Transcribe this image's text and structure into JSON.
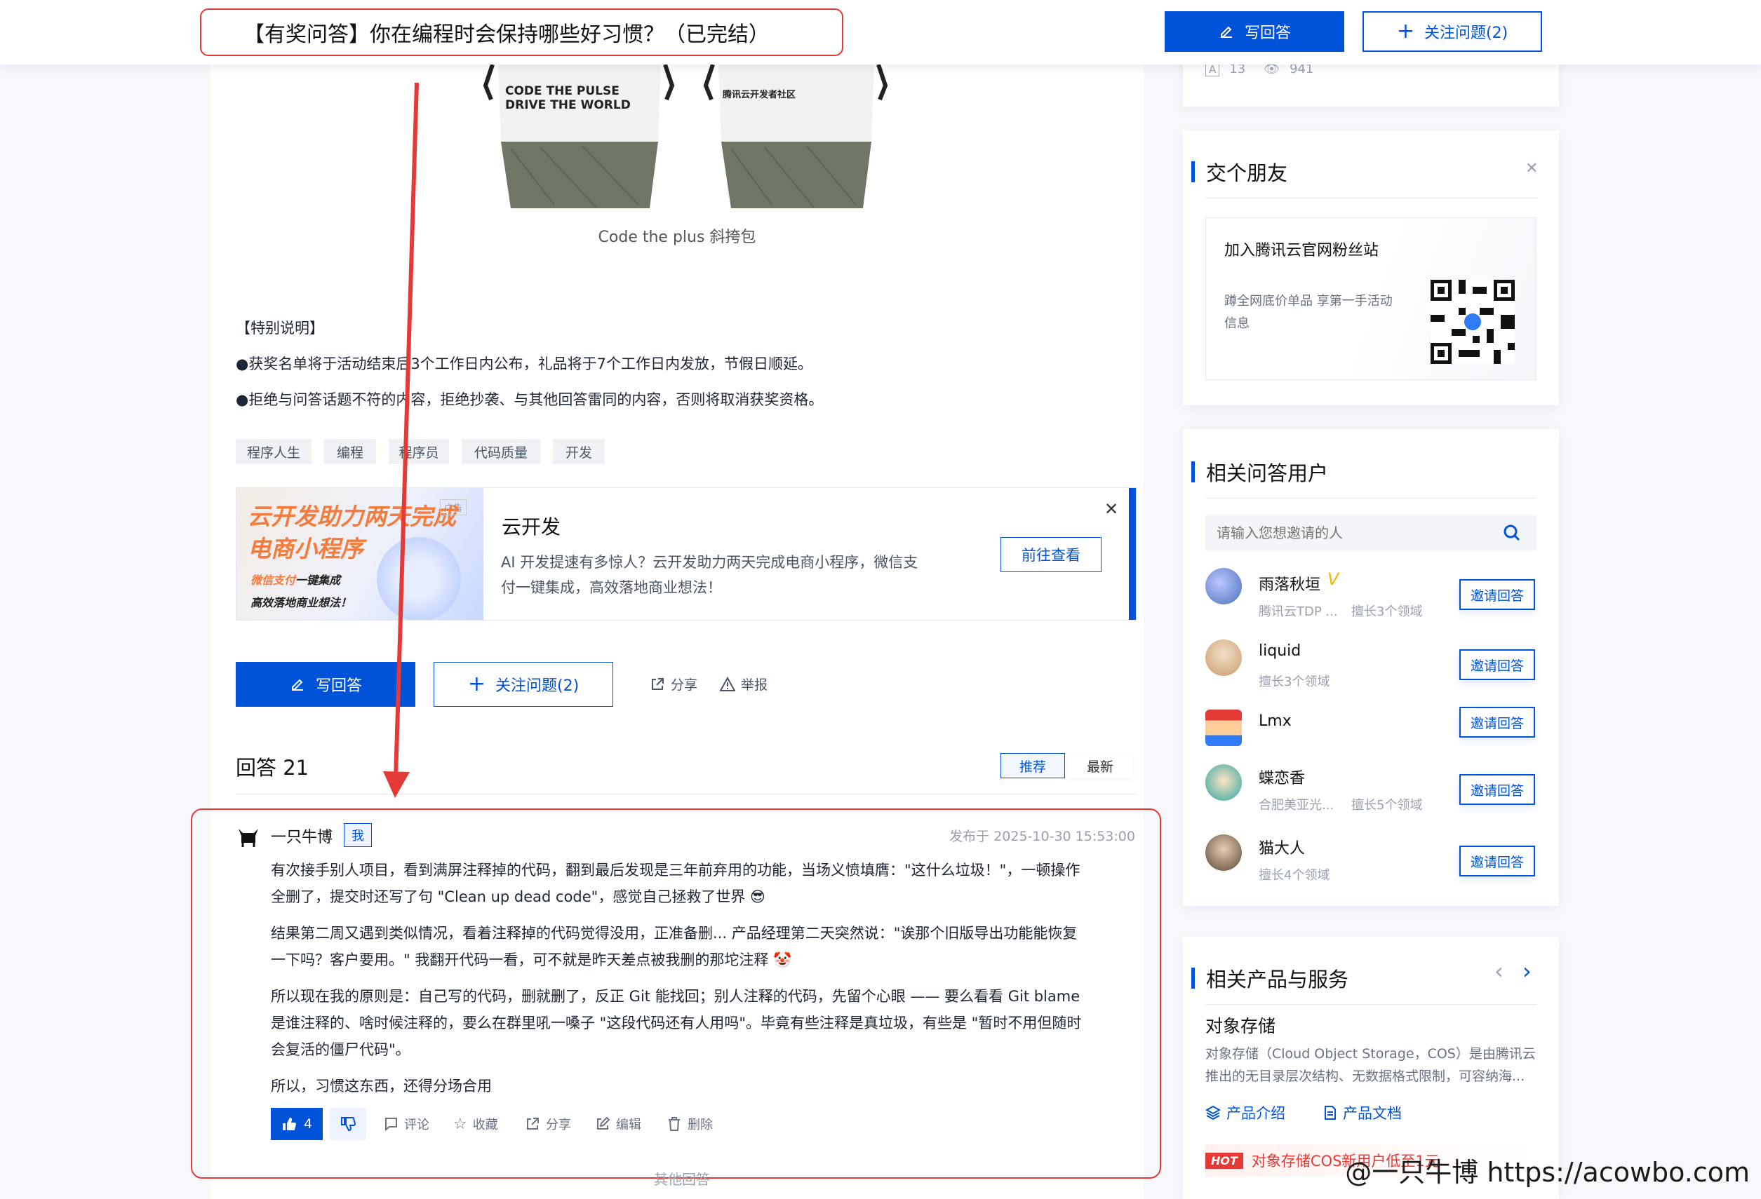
{
  "header": {
    "title": "【有奖问答】你在编程时会保持哪些好习惯？（已完结）",
    "write_answer": "写回答",
    "follow": "关注问题(2)"
  },
  "stats": {
    "answers": "13",
    "views": "941"
  },
  "image": {
    "left_text_line1": "CODE THE PULSE",
    "left_text_line2": "DRIVE THE WORLD",
    "right_text": "腾讯云开发者社区",
    "caption": "Code the plus 斜挎包"
  },
  "notes": {
    "heading": "【特别说明】",
    "line1": "●获奖名单将于活动结束后3个工作日内公布，礼品将于7个工作日内发放，节假日顺延。",
    "line2": "●拒绝与问答话题不符的内容，拒绝抄袭、与其他回答雷同的内容，否则将取消获奖资格。"
  },
  "tags": [
    "程序人生",
    "编程",
    "程序员",
    "代码质量",
    "开发"
  ],
  "ad": {
    "img_title1": "云开发助力两天完成",
    "img_title2": "电商小程序",
    "img_sub1_pre": "微信支付",
    "img_sub1_post": "一键集成",
    "img_sub2": "高效落地商业想法！",
    "img_badge": "广告",
    "title": "云开发",
    "desc1": "AI 开发提速有多惊人？云开发助力两天完成电商小程序，微信支",
    "desc2": "付一键集成，高效落地商业想法！",
    "cta": "前往查看",
    "close": "✕"
  },
  "actions": {
    "write_answer": "写回答",
    "follow": "关注问题(2)",
    "share": "分享",
    "report": "举报"
  },
  "answers_header": {
    "title": "回答 21",
    "sort_recommend": "推荐",
    "sort_latest": "最新"
  },
  "answer": {
    "author": "一只牛博",
    "me_badge": "我",
    "published": "发布于 2025-10-30 15:53:00",
    "p1a": "有次接手别人项目，看到满屏注释掉的代码，翻到最后发现是三年前弃用的功能，当场义愤填膺：\"这什么垃圾！\"，一顿操作",
    "p1b": "全删了，提交时还写了句 \"Clean up dead code\"，感觉自己拯救了世界 😎",
    "p2a": "结果第二周又遇到类似情况，看着注释掉的代码觉得没用，正准备删... 产品经理第二天突然说：\"诶那个旧版导出功能能恢复",
    "p2b": "一下吗？客户要用。\" 我翻开代码一看，可不就是昨天差点被我删的那坨注释 🤡",
    "p3a": "所以现在我的原则是：自己写的代码，删就删了，反正 Git 能找回；别人注释的代码，先留个心眼 —— 要么看看 Git blame",
    "p3b": "是谁注释的、啥时候注释的，要么在群里吼一嗓子 \"这段代码还有人用吗\"。毕竟有些注释是真垃圾，有些是 \"暂时不用但随时",
    "p3c": "会复活的僵尸代码\"。",
    "p4": "所以，习惯这东西，还得分场合用",
    "likes": "4",
    "comment": "评论",
    "collect": "收藏",
    "share": "分享",
    "edit": "编辑",
    "delete": "删除"
  },
  "other_answers": "其他回答",
  "sidebar": {
    "friends": {
      "title": "交个朋友",
      "close": "✕",
      "heading": "加入腾讯云官网粉丝站",
      "desc1": "蹲全网底价单品 享第一手活动",
      "desc2": "信息"
    },
    "users": {
      "title": "相关问答用户",
      "search_placeholder": "请输入您想邀请的人",
      "invite_label": "邀请回答",
      "items": [
        {
          "name": "雨落秋垣",
          "badge": "V",
          "sub1": "腾讯云TDP ...",
          "sub2": "擅长3个领域"
        },
        {
          "name": "liquid",
          "sub1": "擅长3个领域"
        },
        {
          "name": "Lmx"
        },
        {
          "name": "蝶恋香",
          "sub1": "合肥美亚光...",
          "sub2": "擅长5个领域"
        },
        {
          "name": "猫大人",
          "sub1": "擅长4个领域"
        }
      ]
    },
    "products": {
      "title": "相关产品与服务",
      "prev": "‹",
      "next": "›",
      "name": "对象存储",
      "desc1": "对象存储（Cloud Object Storage，COS）是由腾讯云",
      "desc2": "推出的无目录层次结构、无数据格式限制，可容纳海...",
      "intro": "产品介绍",
      "docs": "产品文档",
      "hot": "HOT",
      "promo": "对象存储COS新用户低至1元"
    }
  },
  "watermark": "@一只牛博 https://acowbo.com",
  "colors": {
    "accent": "#0052d9",
    "annotation": "#e53935"
  }
}
